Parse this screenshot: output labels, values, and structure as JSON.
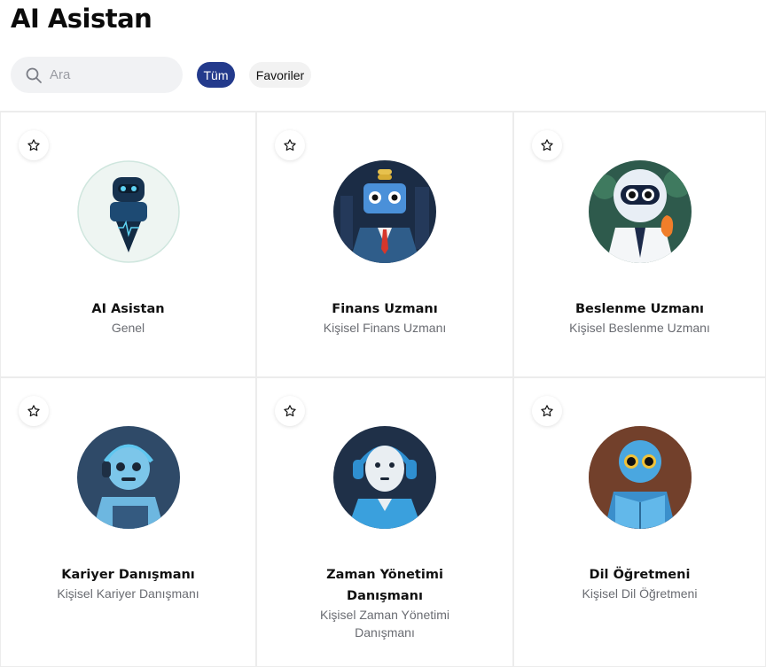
{
  "header": {
    "title": "AI Asistan"
  },
  "search": {
    "placeholder": "Ara"
  },
  "filters": {
    "all_label": "Tüm",
    "favorites_label": "Favoriler"
  },
  "colors": {
    "accent": "#233a8c"
  },
  "cards": [
    {
      "name": "AI Asistan",
      "subtitle": "Genel",
      "icon": "star-outline-icon"
    },
    {
      "name": "Finans Uzmanı",
      "subtitle": "Kişisel Finans Uzmanı",
      "icon": "star-outline-icon"
    },
    {
      "name": "Beslenme Uzmanı",
      "subtitle": "Kişisel Beslenme Uzmanı",
      "icon": "star-outline-icon"
    },
    {
      "name": "Kariyer Danışmanı",
      "subtitle": "Kişisel Kariyer Danışmanı",
      "icon": "star-outline-icon"
    },
    {
      "name": "Zaman Yönetimi Danışmanı",
      "subtitle": "Kişisel Zaman Yönetimi Danışmanı",
      "icon": "star-outline-icon"
    },
    {
      "name": "Dil Öğretmeni",
      "subtitle": "Kişisel Dil Öğretmeni",
      "icon": "star-outline-icon"
    }
  ]
}
